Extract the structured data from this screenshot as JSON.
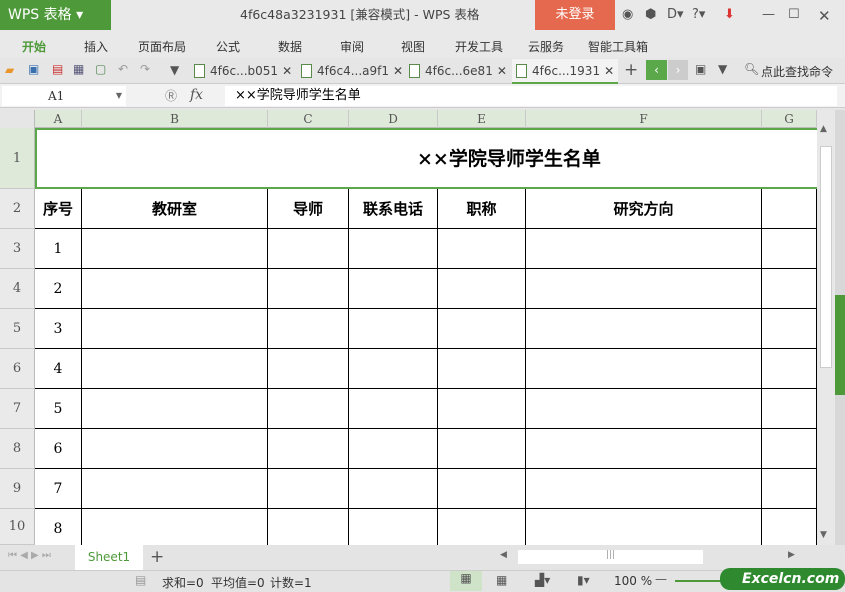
{
  "app": {
    "logo": "WPS 表格",
    "title": "4f6c48a3231931 [兼容模式] - WPS 表格",
    "login": "未登录"
  },
  "menu": [
    "开始",
    "插入",
    "页面布局",
    "公式",
    "数据",
    "审阅",
    "视图",
    "开发工具",
    "云服务",
    "智能工具箱"
  ],
  "doc_tabs": [
    "4f6c...b051",
    "4f6c4...a9f1",
    "4f6c...6e81",
    "4f6c...1931"
  ],
  "search_cmd": "点此查找命令",
  "formula": {
    "cell_ref": "A1",
    "fx": "fx",
    "value": "××学院导师学生名单"
  },
  "columns": [
    "A",
    "B",
    "C",
    "D",
    "E",
    "F",
    "G"
  ],
  "rows": [
    "1",
    "2",
    "3",
    "4",
    "5",
    "6",
    "7",
    "8",
    "9",
    "10"
  ],
  "sheet": {
    "title": "××学院导师学生名单",
    "headers": [
      "序号",
      "教研室",
      "导师",
      "联系电话",
      "职称",
      "研究方向",
      ""
    ],
    "serials": [
      "1",
      "2",
      "3",
      "4",
      "5",
      "6",
      "7",
      "8"
    ]
  },
  "sheet_tab": "Sheet1",
  "status": {
    "sum": "求和=0",
    "avg": "平均值=0",
    "count": "计数=1",
    "zoom": "100 %"
  },
  "watermark": "Excelcn.com"
}
